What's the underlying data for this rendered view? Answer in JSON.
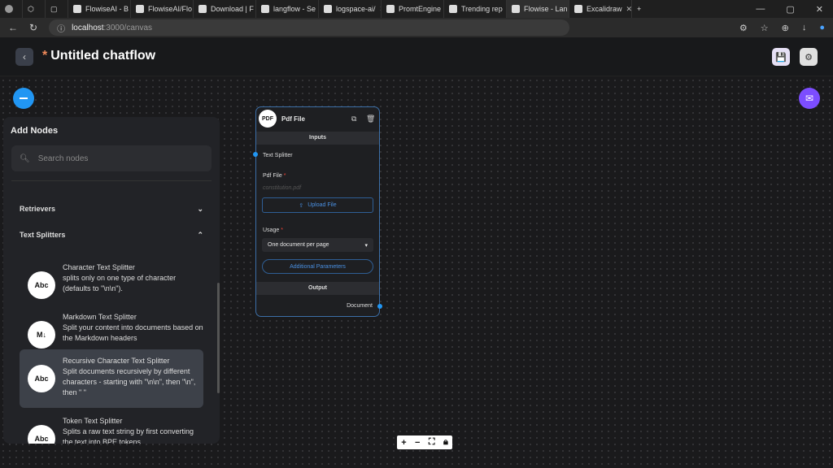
{
  "browser": {
    "tabs": [
      {
        "label": "FlowiseAI - B"
      },
      {
        "label": "FlowiseAI/Flo"
      },
      {
        "label": "Download | F"
      },
      {
        "label": "langflow - Se"
      },
      {
        "label": "logspace-ai/"
      },
      {
        "label": "PromtEngine"
      },
      {
        "label": "Trending rep"
      },
      {
        "label": "Flowise - Lan",
        "active": true
      },
      {
        "label": "Excalidraw"
      }
    ],
    "url_host": "localhost",
    "url_path": ":3000/canvas"
  },
  "header": {
    "modified_marker": "*",
    "title": "Untitled chatflow"
  },
  "add_nodes": {
    "title": "Add Nodes",
    "search_placeholder": "Search nodes",
    "categories": [
      {
        "label": "Retrievers",
        "expanded": false
      },
      {
        "label": "Text Splitters",
        "expanded": true
      }
    ],
    "items": [
      {
        "icon": "Abc",
        "name": "Character Text Splitter",
        "desc": "splits only on one type of character (defaults to \"\\n\\n\")."
      },
      {
        "icon": "M↓",
        "name": "Markdown Text Splitter",
        "desc": "Split your content into documents based on the Markdown headers"
      },
      {
        "icon": "Abc",
        "name": "Recursive Character Text Splitter",
        "desc": "Split documents recursively by different characters - starting with \"\\n\\n\", then \"\\n\", then \" \""
      },
      {
        "icon": "Abc",
        "name": "Token Text Splitter",
        "desc": "Splits a raw text string by first converting the text into BPE tokens"
      }
    ]
  },
  "node": {
    "icon": "PDF",
    "title": "Pdf File",
    "inputs_label": "Inputs",
    "text_splitter": "Text Splitter",
    "pdf_file_label": "Pdf File",
    "required": "*",
    "file_name": "constitution.pdf",
    "upload_label": "Upload File",
    "usage_label": "Usage",
    "usage_value": "One document per page",
    "additional_params": "Additional Parameters",
    "output_label": "Output",
    "document": "Document"
  }
}
